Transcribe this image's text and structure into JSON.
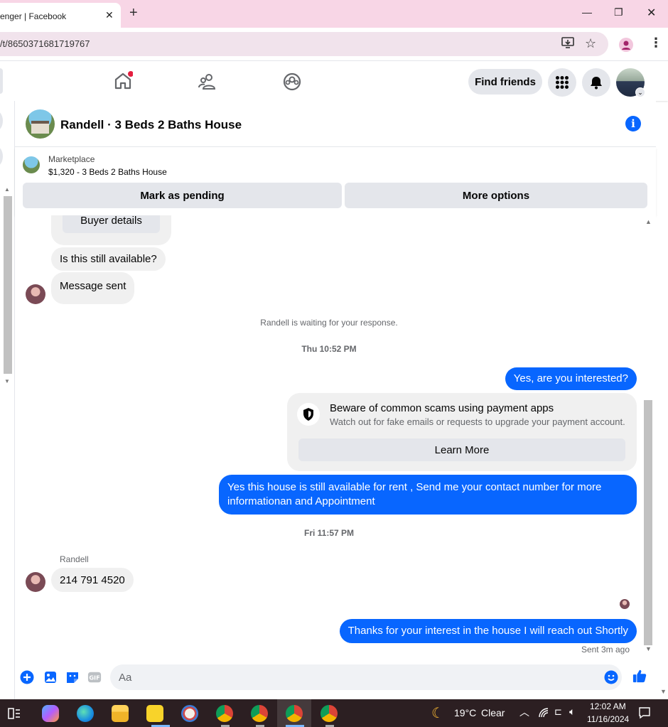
{
  "browser": {
    "tab_title": "enger | Facebook",
    "url": "/t/8650371681719767"
  },
  "header": {
    "find_friends_label": "Find friends"
  },
  "chat": {
    "title": "Randell · 3 Beds 2 Baths House"
  },
  "marketplace": {
    "label": "Marketplace",
    "listing": "$1,320 - 3 Beds 2 Baths House",
    "mark_pending_label": "Mark as pending",
    "more_options_label": "More options"
  },
  "messages": {
    "buyer_details_label": "Buyer details",
    "incoming_1": "Is this still available?",
    "incoming_2": "Message sent",
    "waiting_notice": "Randell is waiting for your response.",
    "timestamp_1": "Thu 10:52 PM",
    "outgoing_1": "Yes, are you interested?",
    "scam_title": "Beware of common scams using payment apps",
    "scam_subtitle": "Watch out for fake emails or requests to upgrade your payment account.",
    "learn_more_label": "Learn More",
    "outgoing_2": "Yes this house is still available for rent , Send me your contact number for more informationan and Appointment",
    "timestamp_2": "Fri 11:57 PM",
    "sender_name": "Randell",
    "incoming_3": "214 791 4520",
    "outgoing_3": "Thanks for your interest in the house I will reach out Shortly",
    "sent_status": "Sent 3m ago"
  },
  "composer": {
    "placeholder": "Aa"
  },
  "taskbar": {
    "temperature": "19°C",
    "weather": "Clear",
    "time": "12:02 AM",
    "date": "11/16/2024"
  },
  "colors": {
    "messenger_blue": "#0866ff",
    "bubble_gray": "#f0f0f0",
    "button_gray": "#e4e6eb",
    "tab_strip_pink": "#f8d6e6"
  }
}
